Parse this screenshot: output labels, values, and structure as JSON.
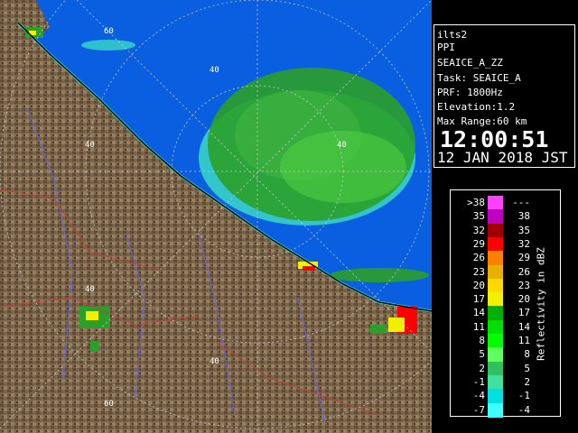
{
  "map": {
    "range_labels": [
      "60",
      "40",
      "40",
      "40",
      "40",
      "60",
      "40"
    ],
    "colors": {
      "sea": "#0a5fe0",
      "land": "#7a6348",
      "land_dark": "#5a4834",
      "land_light": "#a08a68",
      "echo_green": "#2aa02a",
      "echo_cyan": "#3ad8c8",
      "echo_light_green": "#6ee060",
      "river": "#6b64d8",
      "border": "#c0403a",
      "ring": "#c8c8c8"
    }
  },
  "info": {
    "lines": [
      "ilts2",
      "PPI",
      "SEAICE_A_ZZ",
      "Task: SEAICE_A",
      "PRF: 1800Hz",
      "Elevation:1.2",
      "Max Range:60 km"
    ],
    "time": "12:00:51",
    "date": "12 JAN 2018 JST"
  },
  "legend": {
    "title": "Reflectivity in dBZ",
    "rows": [
      {
        "lo": ">38",
        "hi": "---",
        "color": "#ff40ff"
      },
      {
        "lo": "35",
        "hi": "38",
        "color": "#c000c0"
      },
      {
        "lo": "32",
        "hi": "35",
        "color": "#a00000"
      },
      {
        "lo": "29",
        "hi": "32",
        "color": "#ff0000"
      },
      {
        "lo": "26",
        "hi": "29",
        "color": "#ff8000"
      },
      {
        "lo": "23",
        "hi": "26",
        "color": "#e8b000"
      },
      {
        "lo": "20",
        "hi": "23",
        "color": "#ffd800"
      },
      {
        "lo": "17",
        "hi": "20",
        "color": "#f0f000"
      },
      {
        "lo": "14",
        "hi": "17",
        "color": "#00b000"
      },
      {
        "lo": "11",
        "hi": "14",
        "color": "#00e000"
      },
      {
        "lo": "8",
        "hi": "11",
        "color": "#00ff00"
      },
      {
        "lo": "5",
        "hi": "8",
        "color": "#60ff60"
      },
      {
        "lo": "2",
        "hi": "5",
        "color": "#30c060"
      },
      {
        "lo": "-1",
        "hi": "2",
        "color": "#40e0a0"
      },
      {
        "lo": "-4",
        "hi": "-1",
        "color": "#00e0e0"
      },
      {
        "lo": "-7",
        "hi": "-4",
        "color": "#40ffff"
      }
    ]
  }
}
